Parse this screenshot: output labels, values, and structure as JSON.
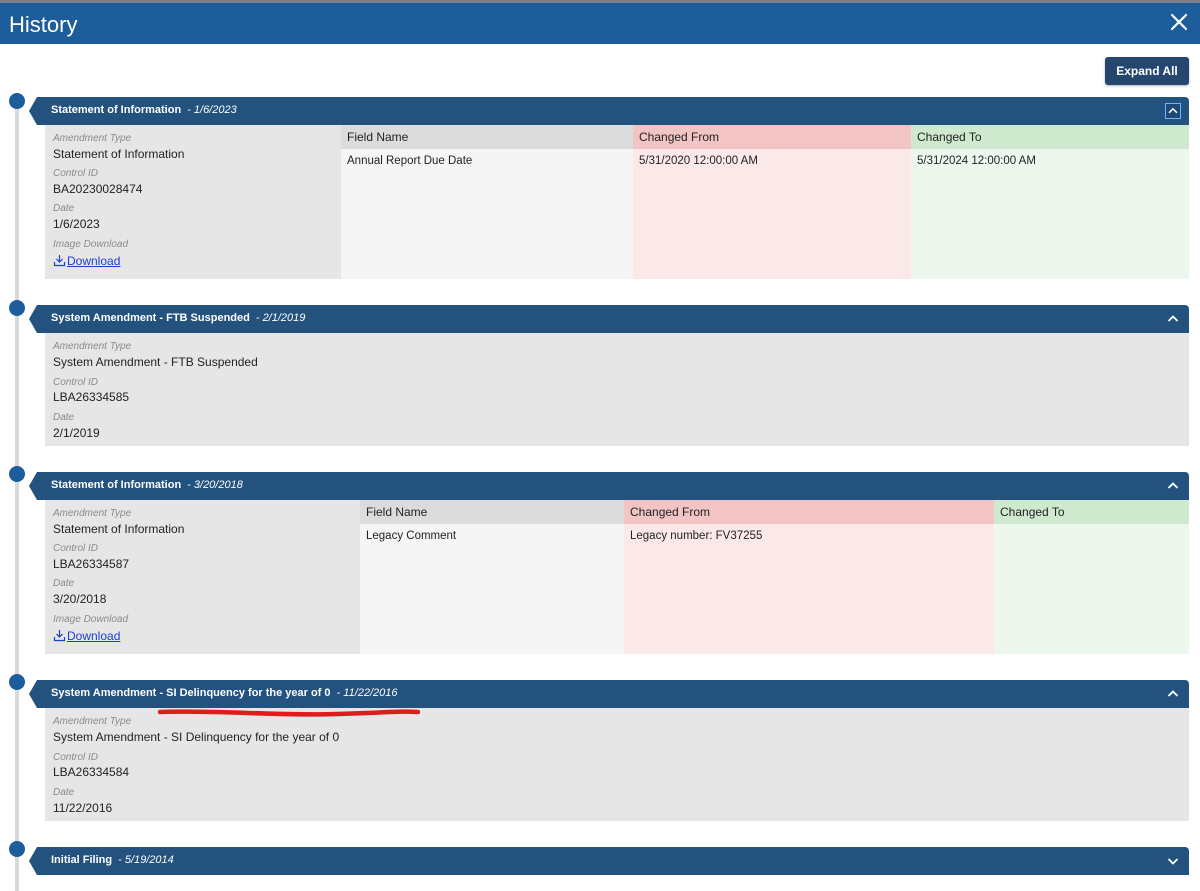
{
  "window": {
    "title": "History"
  },
  "toolbar": {
    "expand_all_label": "Expand All"
  },
  "labels": {
    "amendment_type": "Amendment Type",
    "control_id": "Control ID",
    "date": "Date",
    "image_download": "Image Download",
    "download_link": "Download",
    "field_name": "Field Name",
    "changed_from": "Changed From",
    "changed_to": "Changed To"
  },
  "sections": [
    {
      "title": "Statement of Information",
      "date": "- 1/6/2023",
      "amendment_type": "Statement of Information",
      "control_id": "BA20230028474",
      "date_value": "1/6/2023",
      "changes": {
        "field_name": "Annual Report Due Date",
        "changed_from": "5/31/2020 12:00:00 AM",
        "changed_to": "5/31/2024 12:00:00 AM"
      }
    },
    {
      "title": "System Amendment - FTB Suspended",
      "date": "- 2/1/2019",
      "amendment_type": "System Amendment - FTB Suspended",
      "control_id": "LBA26334585",
      "date_value": "2/1/2019"
    },
    {
      "title": "Statement of Information",
      "date": "- 3/20/2018",
      "amendment_type": "Statement of Information",
      "control_id": "LBA26334587",
      "date_value": "3/20/2018",
      "changes": {
        "field_name": "Legacy Comment",
        "changed_from": "Legacy number: FV37255",
        "changed_to": ""
      }
    },
    {
      "title": "System Amendment - SI Delinquency for the year of 0",
      "date": "- 11/22/2016",
      "amendment_type": "System Amendment - SI Delinquency for the year of 0",
      "control_id": "LBA26334584",
      "date_value": "11/22/2016"
    },
    {
      "title": "Initial Filing",
      "date": "- 5/19/2014"
    }
  ],
  "colors": {
    "title_bar": "#1d5d9b",
    "section_header": "#24527f",
    "changed_from_bg": "#fbe9e9",
    "changed_to_bg": "#eef7ee",
    "annotation_red": "#e01b1b"
  }
}
